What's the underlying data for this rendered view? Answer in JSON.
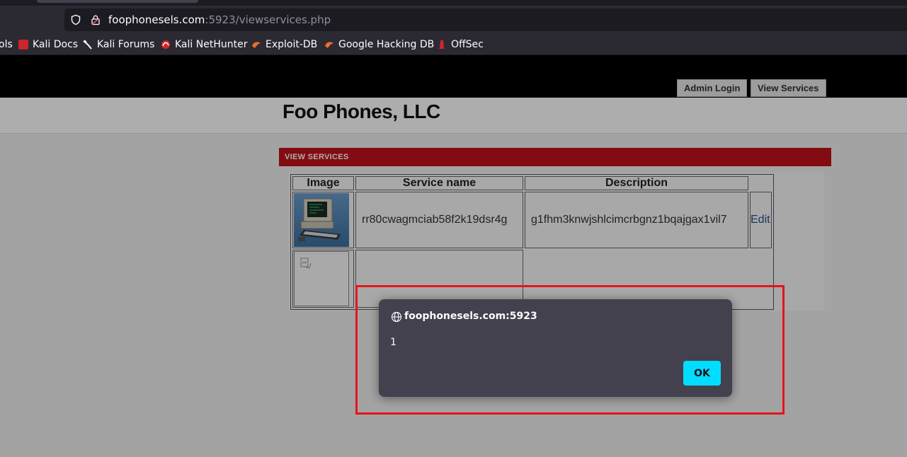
{
  "browser": {
    "url": {
      "host": "foophonesels.com",
      "rest": ":5923/viewservices.php"
    },
    "bookmarks": [
      {
        "label": "ols",
        "icon": "kali-tools-icon"
      },
      {
        "label": "Kali Docs",
        "icon": "kali-docs-icon"
      },
      {
        "label": "Kali Forums",
        "icon": "kali-forums-icon"
      },
      {
        "label": "Kali NetHunter",
        "icon": "kali-nethunter-icon"
      },
      {
        "label": "Exploit-DB",
        "icon": "exploit-db-icon"
      },
      {
        "label": "Google Hacking DB",
        "icon": "google-hacking-db-icon"
      },
      {
        "label": "OffSec",
        "icon": "offsec-icon"
      }
    ]
  },
  "page": {
    "nav": {
      "admin_login": "Admin Login",
      "view_services": "View Services"
    },
    "site_title": "Foo Phones, LLC",
    "section_title": "VIEW SERVICES",
    "table": {
      "headers": {
        "image": "Image",
        "service_name": "Service name",
        "description": "Description"
      },
      "rows": [
        {
          "service_name": "rr80cwagmciab58f2k19dsr4g",
          "description": "g1fhm3knwjshlcimcrbgnz1bqajgax1vil7",
          "edit": "Edit",
          "image": "computer-image"
        },
        {
          "service_name": "",
          "description": "",
          "edit": "",
          "image": "broken-image-icon"
        }
      ]
    }
  },
  "dialog": {
    "origin": "foophonesels.com:5923",
    "message": "1",
    "ok_label": "OK"
  },
  "colors": {
    "section_bar": "#c0121a",
    "highlight_box": "#e5151d",
    "dialog_bg": "#42414d",
    "ok_button": "#00ddff"
  }
}
